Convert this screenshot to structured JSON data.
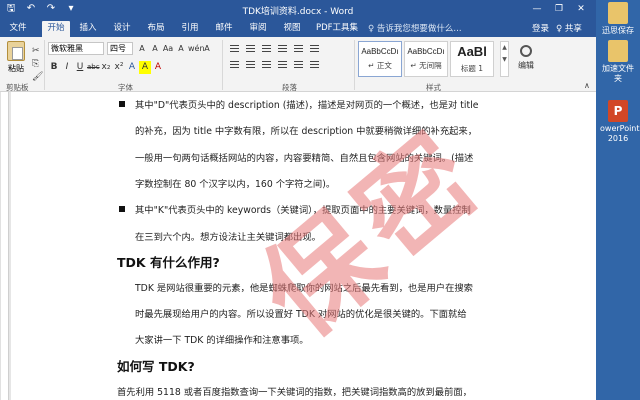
{
  "window": {
    "title": "TDK培训资料.docx - Word",
    "controls": [
      "—",
      "❐",
      "✕"
    ]
  },
  "qat": {
    "save": "🖫",
    "undo": "↶",
    "redo": "↷",
    "more": "▾"
  },
  "tabs": [
    {
      "label": "文件"
    },
    {
      "label": "开始"
    },
    {
      "label": "插入"
    },
    {
      "label": "设计"
    },
    {
      "label": "布局"
    },
    {
      "label": "引用"
    },
    {
      "label": "邮件"
    },
    {
      "label": "审阅"
    },
    {
      "label": "视图"
    },
    {
      "label": "PDF工具集"
    }
  ],
  "active_tab": "开始",
  "tell_me": "♀ 告诉我您想要做什么...",
  "login": "登录",
  "share": "♀ 共享",
  "ribbon": {
    "clipboard": {
      "paste": "粘贴",
      "group": "剪贴板"
    },
    "font": {
      "name": "微软雅黑",
      "size": "四号",
      "group": "字体",
      "buttons_row1": [
        "A",
        "A",
        "Aa",
        "A",
        "wén",
        "A"
      ],
      "buttons_row2": [
        "B",
        "I",
        "U",
        "abc",
        "x₂",
        "x²",
        "A",
        "A",
        "A"
      ]
    },
    "paragraph": {
      "group": "段落"
    },
    "styles": {
      "group": "样式",
      "items": [
        {
          "preview": "AaBbCcDı",
          "name": "↵ 正文"
        },
        {
          "preview": "AaBbCcDı",
          "name": "↵ 无间隔"
        },
        {
          "preview": "AaBl",
          "name": "标题 1"
        }
      ]
    },
    "editing": {
      "label": "编辑"
    }
  },
  "document": {
    "lines": [
      {
        "bullet": true,
        "text": "其中\"D\"代表页头中的 description (描述)，描述是对网页的一个概述，也是对 title"
      },
      {
        "bullet": false,
        "text": "的补充，因为 title 中字数有限，所以在 description 中就要稍微详细的补充起来，"
      },
      {
        "bullet": false,
        "text": "一般用一句两句话概括网站的内容，内容要精简、自然且包含网站的关键词。(描述"
      },
      {
        "bullet": false,
        "text": "字数控制在 80 个汉字以内，160 个字符之间)。"
      },
      {
        "bullet": true,
        "text": "其中\"K\"代表页头中的 keywords（关键词），提取页面中的主要关键词，数量控制"
      },
      {
        "bullet": false,
        "text": "在三到六个内。想方设法让主关键词都出现。"
      }
    ],
    "heading1": "TDK 有什么作用?",
    "para2": [
      "TDK 是网站很重要的元素，他是蜘蛛爬取你的网站之后最先看到，也是用户在搜索",
      "时最先展现给用户的内容。所以设置好 TDK 对网站的优化是很关键的。下面就给",
      "大家讲一下 TDK 的详细操作和注意事项。"
    ],
    "heading2": "如何写 TDK?",
    "para3": "首先利用 5118 或者百度指数查询一下关键词的指数，把关键词指数高的放到最前面，",
    "watermark": "保密"
  },
  "desktop": [
    {
      "label": "迅思保存"
    },
    {
      "label": "加速文件夹"
    },
    {
      "label": "owerPoint 2016"
    }
  ]
}
